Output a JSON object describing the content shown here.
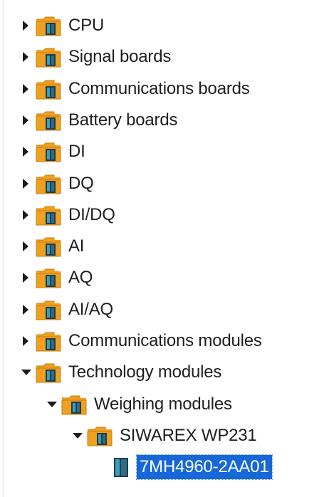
{
  "tree": {
    "items": [
      {
        "label": "CPU",
        "icon": "folder-module-icon",
        "state": "collapsed",
        "level": 0
      },
      {
        "label": "Signal boards",
        "icon": "folder-module-icon",
        "state": "collapsed",
        "level": 0
      },
      {
        "label": "Communications boards",
        "icon": "folder-module-icon",
        "state": "collapsed",
        "level": 0
      },
      {
        "label": "Battery boards",
        "icon": "folder-module-icon",
        "state": "collapsed",
        "level": 0
      },
      {
        "label": "DI",
        "icon": "folder-module-icon",
        "state": "collapsed",
        "level": 0
      },
      {
        "label": "DQ",
        "icon": "folder-module-icon",
        "state": "collapsed",
        "level": 0
      },
      {
        "label": "DI/DQ",
        "icon": "folder-module-icon",
        "state": "collapsed",
        "level": 0
      },
      {
        "label": "AI",
        "icon": "folder-module-icon",
        "state": "collapsed",
        "level": 0
      },
      {
        "label": "AQ",
        "icon": "folder-module-icon",
        "state": "collapsed",
        "level": 0
      },
      {
        "label": "AI/AQ",
        "icon": "folder-module-icon",
        "state": "collapsed",
        "level": 0
      },
      {
        "label": "Communications modules",
        "icon": "folder-module-icon",
        "state": "collapsed",
        "level": 0
      },
      {
        "label": "Technology modules",
        "icon": "folder-module-icon",
        "state": "expanded",
        "level": 0
      },
      {
        "label": "Weighing modules",
        "icon": "folder-module-icon",
        "state": "expanded",
        "level": 1
      },
      {
        "label": "SIWAREX WP231",
        "icon": "folder-module-icon",
        "state": "expanded",
        "level": 2
      },
      {
        "label": "7MH4960-2AA01",
        "icon": "module-icon",
        "state": "leaf",
        "level": 3,
        "selected": true
      }
    ]
  },
  "colors": {
    "folder": "#f0a020",
    "folder_dark": "#c97d0a",
    "module_dark": "#1f3b4f",
    "module_teal": "#3aa0b8",
    "selection": "#1668d8",
    "text": "#1e1e1e"
  }
}
